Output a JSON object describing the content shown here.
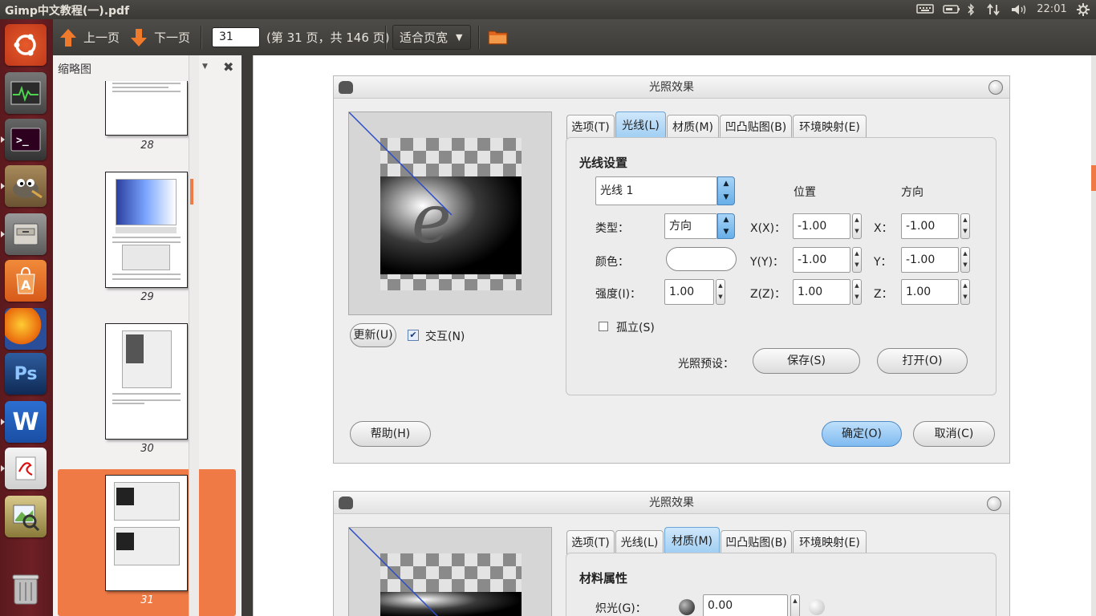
{
  "window": {
    "title": "Gimp中文教程(一).pdf"
  },
  "panel": {
    "time": "22:01"
  },
  "toolbar": {
    "prev_label": "上一页",
    "next_label": "下一页",
    "page_value": "31",
    "page_info": "(第 31 页，共 146 页)",
    "zoom_label": "适合页宽"
  },
  "sidebar": {
    "title": "缩略图",
    "pages": [
      {
        "num": "28"
      },
      {
        "num": "29"
      },
      {
        "num": "30"
      },
      {
        "num": "31"
      }
    ]
  },
  "dialog1": {
    "title": "光照效果",
    "tabs": [
      "选项(T)",
      "光线(L)",
      "材质(M)",
      "凹凸贴图(B)",
      "环境映射(E)"
    ],
    "active_tab": "光线(L)",
    "section_title": "光线设置",
    "light_select": "光线 1",
    "col_position": "位置",
    "col_direction": "方向",
    "type_label": "类型：",
    "type_value": "方向",
    "color_label": "颜色：",
    "intensity_label": "强度(I)：",
    "intensity_value": "1.00",
    "pos_x_label": "X(X)：",
    "pos_y_label": "Y(Y)：",
    "pos_z_label": "Z(Z)：",
    "pos_x": "-1.00",
    "pos_y": "-1.00",
    "pos_z": "1.00",
    "dir_x_label": "X：",
    "dir_y_label": "Y：",
    "dir_z_label": "Z：",
    "dir_x": "-1.00",
    "dir_y": "-1.00",
    "dir_z": "1.00",
    "isolate_label": "孤立(S)",
    "preset_label": "光照预设：",
    "save_label": "保存(S)",
    "open_label": "打开(O)",
    "update_label": "更新(U)",
    "interactive_label": "交互(N)",
    "help_label": "帮助(H)",
    "ok_label": "确定(O)",
    "cancel_label": "取消(C)"
  },
  "dialog2": {
    "title": "光照效果",
    "tabs": [
      "选项(T)",
      "光线(L)",
      "材质(M)",
      "凹凸贴图(B)",
      "环境映射(E)"
    ],
    "active_tab": "材质(M)",
    "section_title": "材料属性",
    "glow_label": "炽光(G)：",
    "glow_value": "0.00"
  },
  "colors": {
    "accent": "#ef7a45",
    "launcher": "#6e2025",
    "tab_active": "#9ecdf2"
  }
}
